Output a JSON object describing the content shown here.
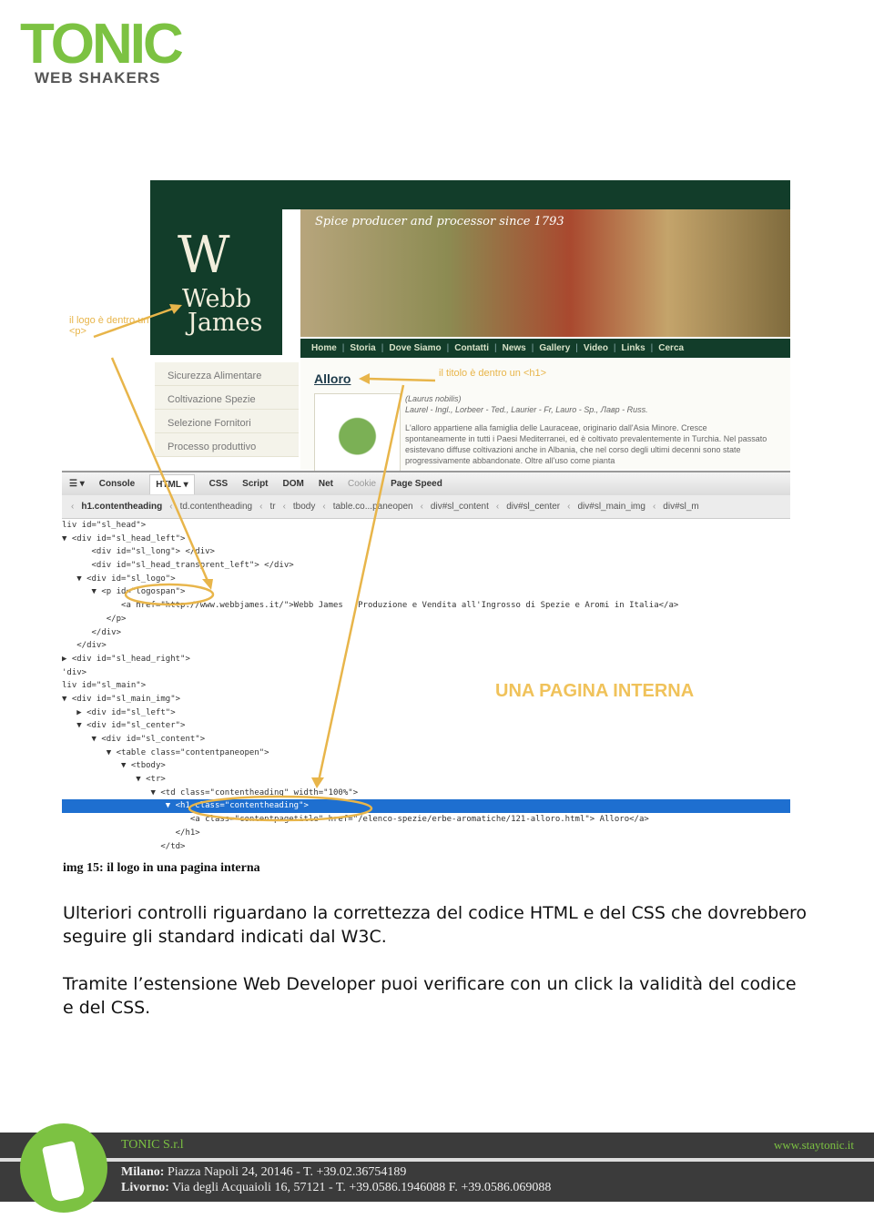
{
  "header": {
    "logo_main": "TONIC",
    "logo_sub": "WEB SHAKERS"
  },
  "figure": {
    "site": {
      "logo_mark": "W",
      "logo_name_1": "Webb",
      "logo_name_2": "James",
      "tagline": "Spice producer and processor since 1793",
      "nav": [
        "Home",
        "Storia",
        "Dove Siamo",
        "Contatti",
        "News",
        "Gallery",
        "Video",
        "Links",
        "Cerca"
      ],
      "left_menu": [
        "Sicurezza Alimentare",
        "Coltivazione Spezie",
        "Selezione Fornitori",
        "Processo produttivo"
      ],
      "page_title": "Alloro",
      "text_1": "(Laurus nobilis)",
      "text_2": "Laurel - Ingl., Lorbeer - Ted., Laurier - Fr, Lauro - Sp., Лавр - Russ.",
      "text_3": "L'alloro appartiene alla famiglia delle Lauraceae, originario dall'Asia Minore. Cresce spontaneamente in tutti i Paesi Mediterranei, ed è coltivato prevalentemente in Turchia. Nel passato esistevano diffuse coltivazioni anche in Albania, che nel corso degli ultimi decenni sono state progressivamente abbandonate. Oltre all'uso come pianta"
    },
    "devtools": {
      "tabs": [
        "Console",
        "HTML ▾",
        "CSS",
        "Script",
        "DOM",
        "Net",
        "Cookie",
        "Page Speed"
      ],
      "breadcrumbs": [
        "h1.contentheading",
        "td.contentheading",
        "tr",
        "tbody",
        "table.co...paneopen",
        "div#sl_content",
        "div#sl_center",
        "div#sl_main_img",
        "div#sl_m"
      ],
      "code_lines": [
        "liv id=\"sl_head\">",
        "▼ <div id=\"sl_head_left\">",
        "      <div id=\"sl_long\"> </div>",
        "      <div id=\"sl_head_transprent_left\"> </div>",
        "   ▼ <div id=\"sl_logo\">",
        "      ▼ <p id=\"logospan\">",
        "            <a href=\"http://www.webbjames.it/\">Webb James   Produzione e Vendita all'Ingrosso di Spezie e Aromi in Italia</a>",
        "         </p>",
        "      </div>",
        "   </div>",
        "▶ <div id=\"sl_head_right\">",
        "'div>",
        "liv id=\"sl_main\">",
        "▼ <div id=\"sl_main_img\">",
        "   ▶ <div id=\"sl_left\">",
        "   ▼ <div id=\"sl_center\">",
        "      ▼ <div id=\"sl_content\">",
        "         ▼ <table class=\"contentpaneopen\">",
        "            ▼ <tbody>",
        "               ▼ <tr>",
        "                  ▼ <td class=\"contentheading\" width=\"100%\">",
        "                     ▼ <h1 class=\"contentheading\">",
        "                          <a class=\"contentpagetitle\" href=\"/elenco-spezie/erbe-aromatiche/121-alloro.html\"> Alloro</a>",
        "                       </h1>",
        "                    </td>"
      ],
      "highlighted_line": 21
    },
    "annotations": {
      "logo": "il logo è dentro un <p>",
      "title": "il titolo è dentro un <h1>",
      "heading": "UNA PAGINA INTERNA"
    },
    "accent_color": "#e8b54a"
  },
  "caption": "img 15: il logo in una pagina interna",
  "paragraphs": [
    "Ulteriori controlli riguardano la correttezza del codice HTML e del CSS che dovrebbero seguire gli standard indicati dal W3C.",
    "Tramite l’estensione Web Developer puoi verificare con un click la validità del codice e del CSS."
  ],
  "footer": {
    "company": "TONIC S.r.l",
    "website": "www.staytonic.it",
    "milano_label": "Milano:",
    "milano": "Piazza Napoli 24, 20146 - T. +39.02.36754189",
    "livorno_label": "Livorno:",
    "livorno": "Via degli Acquaioli 16, 57121 - T. +39.0586.1946088  F. +39.0586.069088",
    "brand_color": "#7cc242"
  }
}
